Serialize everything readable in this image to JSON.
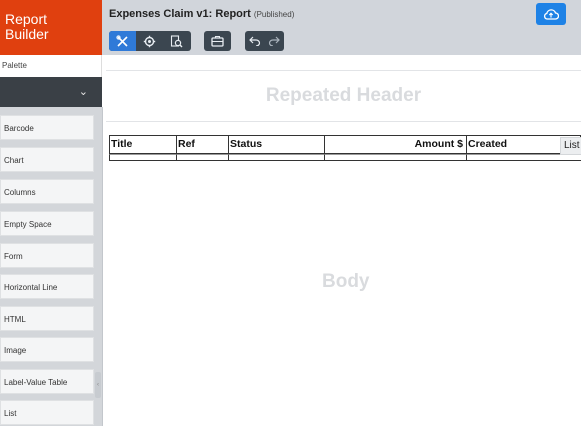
{
  "app": {
    "brand_line1": "Report",
    "brand_line2": "Builder"
  },
  "palette": {
    "label": "Palette",
    "items": [
      "Barcode",
      "Chart",
      "Columns",
      "Empty Space",
      "Form",
      "Horizontal Line",
      "HTML",
      "Image",
      "Label-Value Table",
      "List"
    ]
  },
  "header": {
    "title": "Expenses Claim v1: Report",
    "status": "(Published)"
  },
  "canvas": {
    "header_band": "Repeated Header",
    "body_band": "Body",
    "table": {
      "columns": [
        "Title",
        "Ref",
        "Status",
        "Amount $",
        "Created"
      ]
    },
    "list_tag": "List"
  },
  "colors": {
    "brand": "#e0400f",
    "accent": "#2f7ad8",
    "toolbar": "#3b4650",
    "topbar": "#d1d5db"
  },
  "icons": {
    "tool1": "tools-icon",
    "tool2": "gear-icon",
    "tool3": "preview-search-icon",
    "tool4": "briefcase-icon",
    "undo": "undo-icon",
    "redo": "redo-icon",
    "publish": "cloud-upload-icon",
    "palette_dropdown": "chevron-down-icon"
  }
}
